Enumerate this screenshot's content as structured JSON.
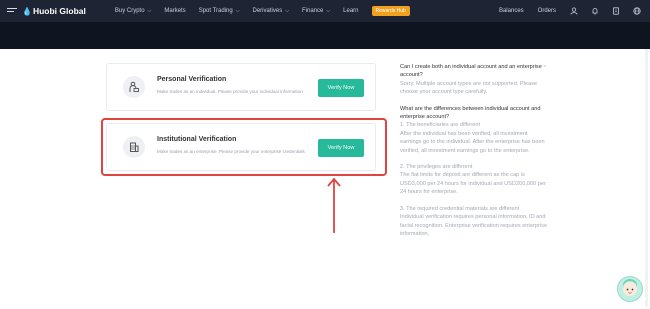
{
  "nav": {
    "brand": "Huobi Global",
    "items": [
      {
        "label": "Buy Crypto",
        "dropdown": true
      },
      {
        "label": "Markets",
        "dropdown": false
      },
      {
        "label": "Spot Trading",
        "dropdown": true
      },
      {
        "label": "Derivatives",
        "dropdown": true
      },
      {
        "label": "Finance",
        "dropdown": true
      },
      {
        "label": "Learn",
        "dropdown": false
      }
    ],
    "rewards_label": "Rewards Hub",
    "balances_label": "Balances",
    "orders_label": "Orders",
    "icons": [
      "menu-icon",
      "user-icon",
      "bell-icon",
      "download-icon",
      "globe-icon"
    ]
  },
  "cards": [
    {
      "title": "Personal Verification",
      "description": "Make trades as an individual. Please provide your individual information",
      "button_label": "Verify Now",
      "icon": "person-icon"
    },
    {
      "title": "Institutional Verification",
      "description": "Make trades as an enterprise. Please provide your enterprise credentials",
      "button_label": "Verify Now",
      "icon": "building-icon"
    }
  ],
  "faq": {
    "q1": "Can I create both an individual account and an enterprise account?",
    "a1": "Sorry. Multiple account types are not supported. Please choose your account type carefully.",
    "q2": "What are the differences between individual account and enterprise account?",
    "a2_head": "1. The beneficiaries are different",
    "a2_body": "After the individual has been verified, all investment earnings go to the individual. After the enterprise has been verified, all investment earnings go to the enterprise.",
    "a3_head": "2. The privileges are different",
    "a3_body": "The fiat limits for deposit are different as the cap is USD3,000 per 24 hours for individual and USD200,000 per 24 hours for enterprise.",
    "a4_head": "3. The required credential materials are different",
    "a4_body": "Individual verification requires personal information, ID and facial recognition. Enterprise verification requires enterprise information,"
  },
  "colors": {
    "nav_bg": "#1e2433",
    "accent": "#26b99a",
    "highlight": "#e0443f",
    "rewards": "#f0a21e"
  }
}
